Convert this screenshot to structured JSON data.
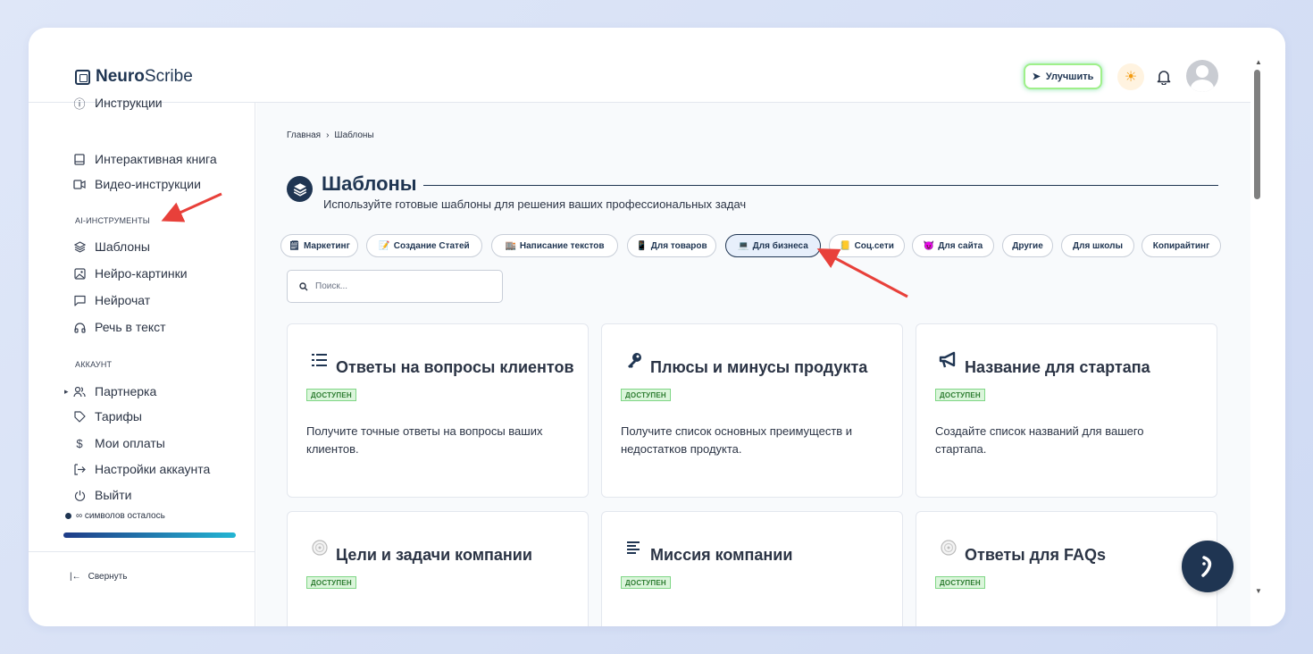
{
  "app": {
    "logo_bold": "Neuro",
    "logo_light": "Scribe"
  },
  "header": {
    "upgrade_label": "Улучшить"
  },
  "sidebar": {
    "items_top": [
      {
        "label": "Инструкции",
        "icon": "help-circle-icon"
      },
      {
        "label": "Интерактивная книга",
        "icon": "book-icon"
      },
      {
        "label": "Видео-инструкции",
        "icon": "video-icon"
      }
    ],
    "section_ai": "AI-ИНСТРУМЕНТЫ",
    "items_ai": [
      {
        "label": "Шаблоны",
        "icon": "layers-icon"
      },
      {
        "label": "Нейро-картинки",
        "icon": "image-icon"
      },
      {
        "label": "Нейрочат",
        "icon": "chat-icon"
      },
      {
        "label": "Речь в текст",
        "icon": "headphones-icon"
      }
    ],
    "section_account": "АККАУНТ",
    "items_account": [
      {
        "label": "Партнерка",
        "icon": "users-icon"
      },
      {
        "label": "Тарифы",
        "icon": "tag-icon"
      },
      {
        "label": "Мои оплаты",
        "icon": "dollar-icon"
      },
      {
        "label": "Настройки аккаунта",
        "icon": "login-icon"
      },
      {
        "label": "Выйти",
        "icon": "power-icon"
      }
    ],
    "symbols_left": "∞ символов осталось",
    "collapse_label": "Свернуть"
  },
  "main": {
    "breadcrumb": [
      "Главная",
      "›",
      "Шаблоны"
    ],
    "title": "Шаблоны",
    "subtitle": "Используйте готовые шаблоны для решения ваших профессиональных задач",
    "categories": [
      {
        "emoji": "🗒",
        "label": "Маркетинг"
      },
      {
        "emoji": "📝",
        "label": "Создание Статей"
      },
      {
        "emoji": "🏬",
        "label": "Написание текстов"
      },
      {
        "emoji": "📱",
        "label": "Для товаров"
      },
      {
        "emoji": "💻",
        "label": "Для бизнеса"
      },
      {
        "emoji": "📒",
        "label": "Соц.сети"
      },
      {
        "emoji": "😈",
        "label": "Для сайта"
      },
      {
        "emoji": "",
        "label": "Другие"
      },
      {
        "emoji": "",
        "label": "Для школы"
      },
      {
        "emoji": "",
        "label": "Копирайтинг"
      }
    ],
    "active_category": "Для бизнеса",
    "search_placeholder": "Поиск...",
    "badge": "ДОСТУПЕН",
    "cards": [
      {
        "icon": "list-icon",
        "title": "Ответы на вопросы клиентов",
        "desc": "Получите точные ответы на вопросы ваших клиентов."
      },
      {
        "icon": "key-icon",
        "title": "Плюсы и минусы продукта",
        "desc": "Получите список основных преимуществ и недостатков продукта."
      },
      {
        "icon": "megaphone-icon",
        "title": "Название для стартапа",
        "desc": "Создайте список названий для вашего стартапа."
      },
      {
        "icon": "target-icon",
        "title": "Цели и задачи компании",
        "desc": ""
      },
      {
        "icon": "text-align-icon",
        "title": "Миссия компании",
        "desc": ""
      },
      {
        "icon": "target-icon",
        "title": "Ответы для FAQs",
        "desc": ""
      }
    ]
  },
  "colors": {
    "primary": "#1f3552",
    "badge_bg": "#dbf5db",
    "arrow": "#e8403a"
  }
}
